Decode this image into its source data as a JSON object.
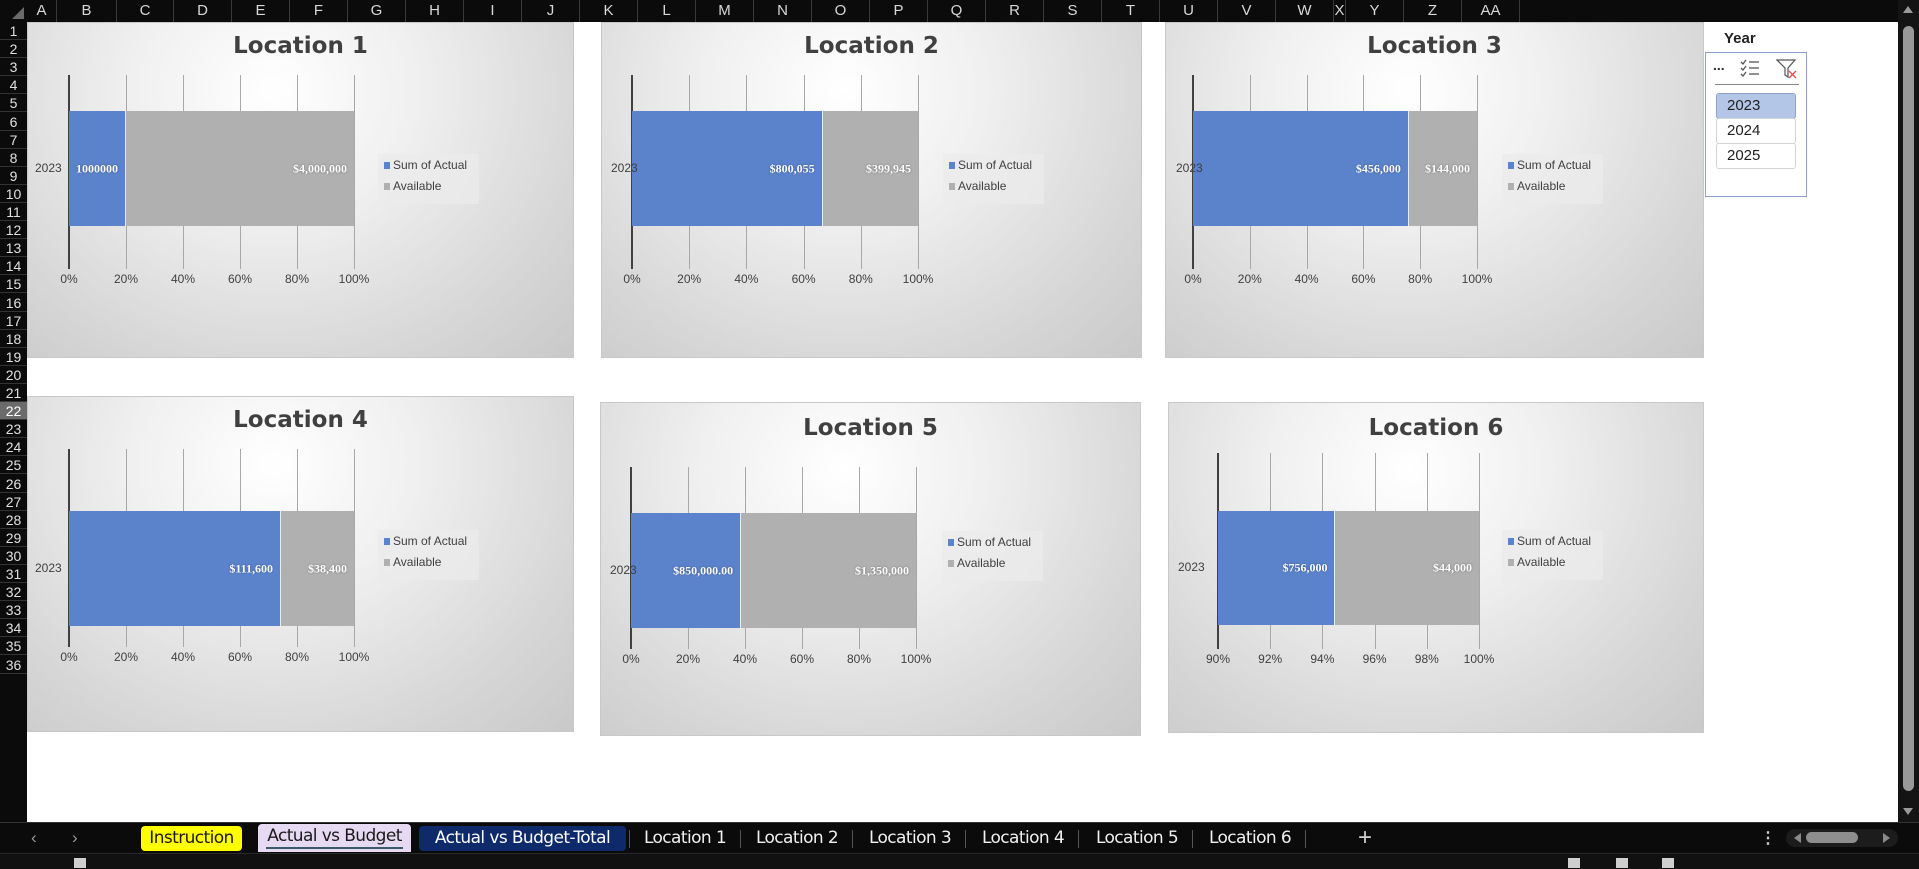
{
  "spreadsheet": {
    "columns": [
      "A",
      "B",
      "C",
      "D",
      "E",
      "F",
      "G",
      "H",
      "I",
      "J",
      "K",
      "L",
      "M",
      "N",
      "O",
      "P",
      "Q",
      "R",
      "S",
      "T",
      "U",
      "V",
      "W",
      "X",
      "Y",
      "Z",
      "AA"
    ],
    "rows": [
      "1",
      "2",
      "3",
      "4",
      "5",
      "6",
      "7",
      "8",
      "9",
      "10",
      "11",
      "12",
      "13",
      "14",
      "15",
      "16",
      "17",
      "18",
      "19",
      "20",
      "21",
      "22",
      "23",
      "24",
      "25",
      "26",
      "27",
      "28",
      "29",
      "30",
      "31",
      "32",
      "33",
      "34",
      "35",
      "36"
    ],
    "active_row": "22"
  },
  "slicer": {
    "title": "Year",
    "tools": {
      "more_label": "...",
      "multi_select_icon": "multi-select-icon",
      "clear_filter_icon": "clear-filter-icon"
    },
    "items": [
      {
        "label": "2023",
        "selected": true
      },
      {
        "label": "2024",
        "selected": false
      },
      {
        "label": "2025",
        "selected": false
      }
    ]
  },
  "colors": {
    "actual": "#5b83cc",
    "available": "#b0b0b0",
    "tab_instruction": "#ffff00",
    "tab_active": "#e6d9f2",
    "tab_total": "#0e2a6b"
  },
  "legend": {
    "actual": "Sum of Actual",
    "available": "Available"
  },
  "chart_data": [
    {
      "type": "bar",
      "orientation": "horizontal",
      "stacked": "100%",
      "title": "Location 1",
      "categories": [
        "2023"
      ],
      "series": [
        {
          "name": "Sum of Actual",
          "values": [
            1000000
          ],
          "label": "1000000"
        },
        {
          "name": "Available",
          "values": [
            4000000
          ],
          "label": "$4,000,000"
        }
      ],
      "xlim": [
        0,
        100
      ],
      "xticks": [
        "0%",
        "20%",
        "40%",
        "60%",
        "80%",
        "100%"
      ],
      "legend": "right",
      "grid": true
    },
    {
      "type": "bar",
      "orientation": "horizontal",
      "stacked": "100%",
      "title": "Location 2",
      "categories": [
        "2023"
      ],
      "series": [
        {
          "name": "Sum of Actual",
          "values": [
            800055
          ],
          "label": "$800,055"
        },
        {
          "name": "Available",
          "values": [
            399945
          ],
          "label": "$399,945"
        }
      ],
      "xlim": [
        0,
        100
      ],
      "xticks": [
        "0%",
        "20%",
        "40%",
        "60%",
        "80%",
        "100%"
      ],
      "legend": "right",
      "grid": true
    },
    {
      "type": "bar",
      "orientation": "horizontal",
      "stacked": "100%",
      "title": "Location 3",
      "categories": [
        "2023"
      ],
      "series": [
        {
          "name": "Sum of Actual",
          "values": [
            456000
          ],
          "label": "$456,000"
        },
        {
          "name": "Available",
          "values": [
            144000
          ],
          "label": "$144,000"
        }
      ],
      "xlim": [
        0,
        100
      ],
      "xticks": [
        "0%",
        "20%",
        "40%",
        "60%",
        "80%",
        "100%"
      ],
      "legend": "right",
      "grid": true
    },
    {
      "type": "bar",
      "orientation": "horizontal",
      "stacked": "100%",
      "title": "Location 4",
      "categories": [
        "2023"
      ],
      "series": [
        {
          "name": "Sum of Actual",
          "values": [
            111600
          ],
          "label": "$111,600"
        },
        {
          "name": "Available",
          "values": [
            38400
          ],
          "label": "$38,400"
        }
      ],
      "xlim": [
        0,
        100
      ],
      "xticks": [
        "0%",
        "20%",
        "40%",
        "60%",
        "80%",
        "100%"
      ],
      "legend": "right",
      "grid": true
    },
    {
      "type": "bar",
      "orientation": "horizontal",
      "stacked": "100%",
      "title": "Location 5",
      "categories": [
        "2023"
      ],
      "series": [
        {
          "name": "Sum of Actual",
          "values": [
            850000
          ],
          "label": "$850,000.00"
        },
        {
          "name": "Available",
          "values": [
            1350000
          ],
          "label": "$1,350,000"
        }
      ],
      "xlim": [
        0,
        100
      ],
      "xticks": [
        "0%",
        "20%",
        "40%",
        "60%",
        "80%",
        "100%"
      ],
      "legend": "right",
      "grid": true
    },
    {
      "type": "bar",
      "orientation": "horizontal",
      "stacked": "100%",
      "title": "Location 6",
      "categories": [
        "2023"
      ],
      "series": [
        {
          "name": "Sum of Actual",
          "values": [
            756000
          ],
          "label": "$756,000"
        },
        {
          "name": "Available",
          "values": [
            44000
          ],
          "label": "$44,000"
        }
      ],
      "xlim": [
        90,
        100
      ],
      "xticks": [
        "90%",
        "92%",
        "94%",
        "96%",
        "98%",
        "100%"
      ],
      "legend": "right",
      "grid": true
    }
  ],
  "tabs": {
    "nav_prev": "‹",
    "nav_next": "›",
    "items": [
      {
        "label": "Instruction",
        "style": "yellow"
      },
      {
        "label": "Actual vs Budget",
        "style": "active"
      },
      {
        "label": "Actual vs Budget-Total",
        "style": "navy"
      },
      {
        "label": "Location 1",
        "style": "plain"
      },
      {
        "label": "Location 2",
        "style": "plain"
      },
      {
        "label": "Location 3",
        "style": "plain"
      },
      {
        "label": "Location 4",
        "style": "plain"
      },
      {
        "label": "Location 5",
        "style": "plain"
      },
      {
        "label": "Location 6",
        "style": "plain"
      }
    ],
    "add_label": "+",
    "more_label": "⋮"
  }
}
